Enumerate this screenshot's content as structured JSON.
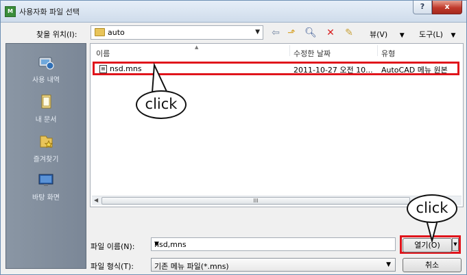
{
  "window": {
    "title": "사용자화 파일 선택",
    "help": "?",
    "close": "x"
  },
  "toolbar": {
    "look_in_label": "찾을 위치(I):",
    "look_in_value": "auto",
    "view_label": "뷰(V)",
    "tools_label": "도구(L)"
  },
  "places": [
    {
      "label": "사용 내역",
      "icon": "history-icon"
    },
    {
      "label": "내 문서",
      "icon": "documents-icon"
    },
    {
      "label": "즐겨찾기",
      "icon": "favorites-icon"
    },
    {
      "label": "바탕 화면",
      "icon": "desktop-icon"
    }
  ],
  "file_list": {
    "columns": [
      "이름",
      "수정한 날짜",
      "유형"
    ],
    "rows": [
      {
        "name": "nsd.mns",
        "modified": "2011-10-27 오전 10...",
        "type": "AutoCAD 메뉴 원본"
      }
    ],
    "scroll_thumb": "III"
  },
  "bottom": {
    "filename_label": "파일 이름(N):",
    "filename_value": "nsd,mns",
    "filetype_label": "파일 형식(T):",
    "filetype_value": "기존 메뉴 파일(*.mns)",
    "open_button": "열기(O)",
    "cancel_button": "취소"
  },
  "annotations": {
    "click1": "click",
    "click2": "click"
  },
  "colors": {
    "highlight": "#e0141b",
    "places_bg": "#7b8797"
  }
}
